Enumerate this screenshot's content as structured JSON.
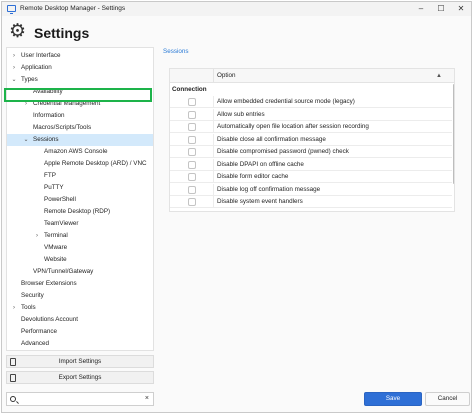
{
  "window": {
    "title": "Remote Desktop Manager - Settings"
  },
  "header": {
    "title": "Settings",
    "icon": "gear-icon"
  },
  "sidebar": {
    "items": [
      {
        "label": "User Interface",
        "chevron": ">",
        "level": 0
      },
      {
        "label": "Application",
        "chevron": ">",
        "level": 0
      },
      {
        "label": "Types",
        "chevron": "v",
        "level": 0
      },
      {
        "label": "Availability",
        "chevron": "",
        "level": 1
      },
      {
        "label": "Credential Management",
        "chevron": ">",
        "level": 1
      },
      {
        "label": "Information",
        "chevron": "",
        "level": 1
      },
      {
        "label": "Macros/Scripts/Tools",
        "chevron": "",
        "level": 1
      },
      {
        "label": "Sessions",
        "chevron": "v",
        "level": 1,
        "selected": true
      },
      {
        "label": "Amazon AWS Console",
        "chevron": "",
        "level": 2
      },
      {
        "label": "Apple Remote Desktop (ARD) / VNC",
        "chevron": "",
        "level": 2
      },
      {
        "label": "FTP",
        "chevron": "",
        "level": 2
      },
      {
        "label": "PuTTY",
        "chevron": "",
        "level": 2
      },
      {
        "label": "PowerShell",
        "chevron": "",
        "level": 2
      },
      {
        "label": "Remote Desktop (RDP)",
        "chevron": "",
        "level": 2
      },
      {
        "label": "TeamViewer",
        "chevron": "",
        "level": 2
      },
      {
        "label": "Terminal",
        "chevron": ">",
        "level": 2
      },
      {
        "label": "VMware",
        "chevron": "",
        "level": 2
      },
      {
        "label": "Website",
        "chevron": "",
        "level": 2
      },
      {
        "label": "VPN/Tunnel/Gateway",
        "chevron": "",
        "level": 1
      },
      {
        "label": "Browser Extensions",
        "chevron": "",
        "level": 0
      },
      {
        "label": "Security",
        "chevron": "",
        "level": 0
      },
      {
        "label": "Tools",
        "chevron": ">",
        "level": 0
      },
      {
        "label": "Devolutions Account",
        "chevron": "",
        "level": 0
      },
      {
        "label": "Performance",
        "chevron": "",
        "level": 0
      },
      {
        "label": "Advanced",
        "chevron": "",
        "level": 0
      }
    ],
    "import_label": "Import Settings",
    "export_label": "Export Settings",
    "search": {
      "value": "",
      "placeholder": "",
      "clear": "×"
    }
  },
  "main": {
    "breadcrumb": "Sessions",
    "grid": {
      "column_header": "Option",
      "group": "Connection",
      "rows": [
        {
          "label": "Allow embedded credential source mode (legacy)",
          "checked": false
        },
        {
          "label": "Allow sub entries",
          "checked": false
        },
        {
          "label": "Automatically open file location after session recording",
          "checked": false
        },
        {
          "label": "Disable close all confirmation message",
          "checked": false
        },
        {
          "label": "Disable compromised password (pwned) check",
          "checked": false
        },
        {
          "label": "Disable DPAPI on offline cache",
          "checked": false
        },
        {
          "label": "Disable form editor cache",
          "checked": false
        },
        {
          "label": "Disable log off confirmation message",
          "checked": false
        },
        {
          "label": "Disable system event handlers",
          "checked": false
        }
      ]
    }
  },
  "footer": {
    "save_label": "Save",
    "cancel_label": "Cancel"
  },
  "colors": {
    "accent": "#2e6fd6",
    "selection": "#d3e9fb",
    "highlight_frame": "#1db34a",
    "link": "#2b7bd6"
  }
}
